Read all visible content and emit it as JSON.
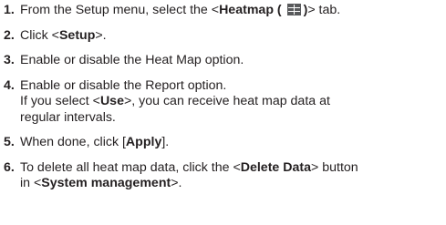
{
  "steps": [
    {
      "num": "1.",
      "pre": "From the Setup menu, select the <",
      "bold": "Heatmap ( ",
      "bold_after": ")",
      "post": "> tab.",
      "icon": "heatmap-grid-icon"
    },
    {
      "num": "2.",
      "pre": "Click <",
      "bold": "Setup",
      "post": ">."
    },
    {
      "num": "3.",
      "text": "Enable or disable the Heat Map option."
    },
    {
      "num": "4.",
      "text": "Enable or disable the Report option.",
      "sub_pre": "If you select <",
      "sub_bold": "Use",
      "sub_post1": ">, you can receive heat map data at",
      "sub_post2": "regular intervals."
    },
    {
      "num": "5.",
      "pre": "When done, click [",
      "bold": "Apply",
      "post": "]."
    },
    {
      "num": "6.",
      "pre": "To delete all heat map data, click the <",
      "bold": "Delete Data",
      "post": "> button",
      "line2_pre": "in <",
      "line2_bold": "System management",
      "line2_post": ">."
    }
  ]
}
